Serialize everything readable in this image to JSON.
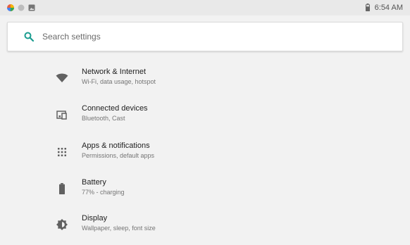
{
  "status_bar": {
    "time": "6:54 AM",
    "left_icons": [
      "app-icon",
      "dot-icon",
      "image-icon"
    ],
    "battery_icon": "battery-icon"
  },
  "search": {
    "placeholder": "Search settings",
    "icon": "search-icon",
    "accent_color": "#1a9c8f"
  },
  "settings": {
    "items": [
      {
        "title": "Network & Internet",
        "subtitle": "Wi-Fi, data usage, hotspot",
        "icon": "wifi-icon"
      },
      {
        "title": "Connected devices",
        "subtitle": "Bluetooth, Cast",
        "icon": "devices-icon"
      },
      {
        "title": "Apps & notifications",
        "subtitle": "Permissions, default apps",
        "icon": "apps-icon"
      },
      {
        "title": "Battery",
        "subtitle": "77% - charging",
        "icon": "battery-icon"
      },
      {
        "title": "Display",
        "subtitle": "Wallpaper, sleep, font size",
        "icon": "brightness-icon"
      }
    ]
  }
}
